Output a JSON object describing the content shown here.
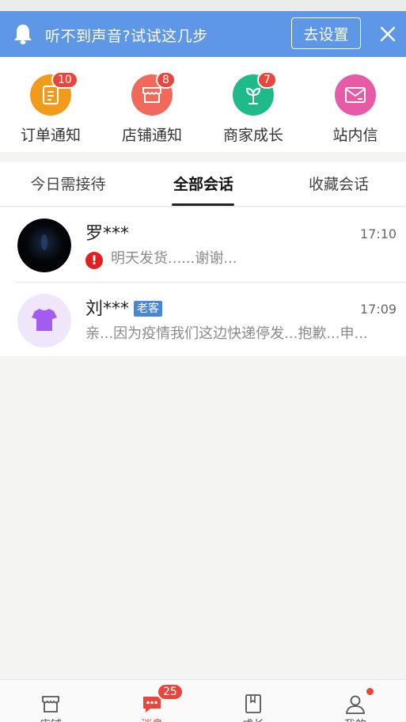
{
  "banner": {
    "text": "听不到声音?试试这几步",
    "button_label": "去设置"
  },
  "quick_entries": [
    {
      "label": "订单通知",
      "badge": "10",
      "icon": "order-notice-icon",
      "color": "#f29a1a"
    },
    {
      "label": "店铺通知",
      "badge": "8",
      "icon": "store-notice-icon",
      "color": "#ef6a5a"
    },
    {
      "label": "商家成长",
      "badge": "7",
      "icon": "growth-sprout-icon",
      "color": "#20b98a"
    },
    {
      "label": "站内信",
      "badge": "",
      "icon": "mail-icon",
      "color": "#e75aa6"
    }
  ],
  "tabs": [
    {
      "label": "今日需接待",
      "active": false
    },
    {
      "label": "全部会话",
      "active": true
    },
    {
      "label": "收藏会话",
      "active": false
    }
  ],
  "conversations": [
    {
      "name": "罗***",
      "tag": "",
      "time": "17:10",
      "alert": "!",
      "preview": "明天发货......谢谢..."
    },
    {
      "name": "刘***",
      "tag": "老客",
      "time": "17:09",
      "alert": "",
      "preview": "亲...因为疫情我们这边快递停发...抱歉...申..."
    }
  ],
  "bottom_nav": [
    {
      "label": "店铺",
      "icon": "store-icon",
      "active": false,
      "badge": ""
    },
    {
      "label": "消息",
      "icon": "message-icon",
      "active": true,
      "badge": "25"
    },
    {
      "label": "成长",
      "icon": "book-icon",
      "active": false,
      "badge": ""
    },
    {
      "label": "我的",
      "icon": "profile-icon",
      "active": false,
      "badge": ""
    }
  ],
  "colors": {
    "banner": "#5d97e6",
    "accent_red": "#e8453c",
    "tag_blue": "#4a86d8"
  }
}
